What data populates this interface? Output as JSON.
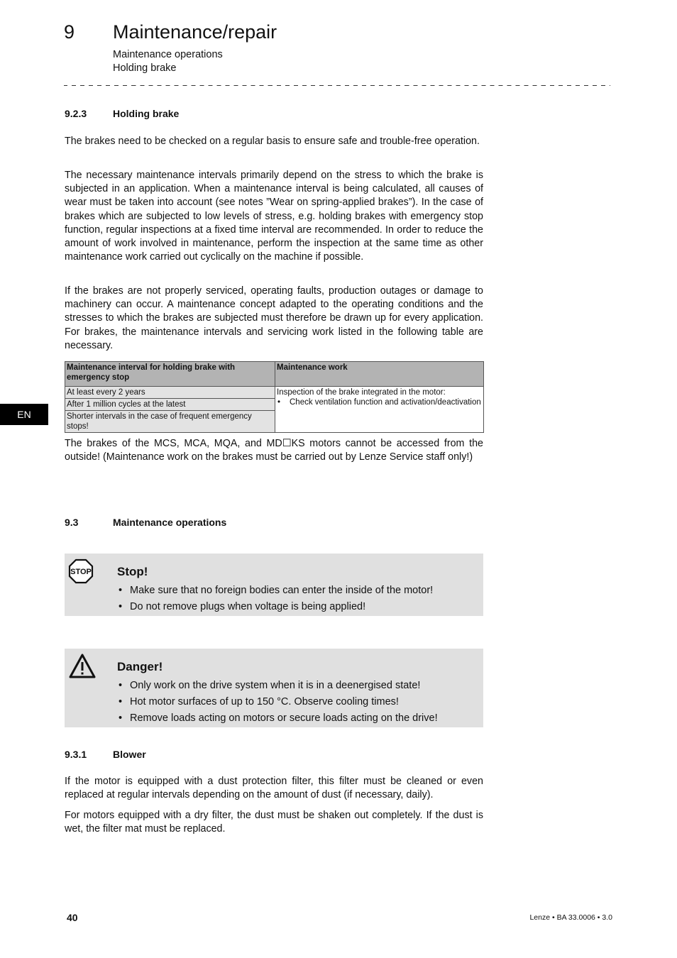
{
  "header": {
    "chapter_number": "9",
    "chapter_title": "Maintenance/repair",
    "subheadings": [
      "Maintenance operations",
      "Holding brake"
    ]
  },
  "side_tab": {
    "language": "EN"
  },
  "section_923": {
    "number": "9.2.3",
    "title": "Holding brake",
    "paragraphs": [
      "The brakes need to be checked on a regular basis to ensure safe and trouble-free operation.",
      "The necessary maintenance intervals primarily depend on the stress to which the brake is subjected in an application. When a maintenance interval is being calculated, all causes of wear must be taken into account (see notes ”Wear on spring-applied brakes”). In the case of brakes which are subjected to low levels of stress, e.g. holding brakes with emergency stop function, regular inspections at a fixed time interval are recommended. In order to reduce the amount of work involved in maintenance, perform the inspection at the same time as other maintenance work carried out cyclically on the machine if possible.",
      "If the brakes are not properly serviced, operating faults, production outages or damage to machinery can occur. A maintenance concept adapted to the operating conditions and the stresses to which the brakes are subjected must therefore be drawn up for every application. For brakes, the maintenance intervals and servicing work listed in the following table are necessary."
    ],
    "table": {
      "headers": [
        "Maintenance interval for holding brake with emergency stop",
        "Maintenance work"
      ],
      "intervals": [
        "At least every 2 years",
        "After 1 million cycles at the latest",
        "Shorter intervals in the case of frequent emergency stops!"
      ],
      "work_intro": "Inspection of the brake integrated in the motor:",
      "work_items": [
        "Check ventilation function and activation/deactivation"
      ]
    },
    "note_after_table": "The brakes of the MCS, MCA, MQA, and MD☐KS motors cannot be accessed from the outside! (Maintenance work on the brakes must be carried out by Lenze Service staff only!)"
  },
  "section_93": {
    "number": "9.3",
    "title": "Maintenance operations",
    "stop_box": {
      "icon": "stop-sign-icon",
      "icon_text": "STOP",
      "title": "Stop!",
      "items": [
        "Make sure that no foreign bodies can enter the inside of the motor!",
        "Do not remove plugs when voltage is being applied!"
      ]
    },
    "danger_box": {
      "icon": "warning-triangle-icon",
      "title": "Danger!",
      "items": [
        "Only work on the drive system when it is in a deenergised state!",
        "Hot motor surfaces of up to 150 °C. Observe cooling times!",
        "Remove loads acting on motors or secure loads acting on the drive!"
      ]
    }
  },
  "section_931": {
    "number": "9.3.1",
    "title": "Blower",
    "paragraphs": [
      "If the motor is equipped with a dust protection filter, this filter must be cleaned or even replaced at regular intervals depending on the amount of dust (if necessary, daily).",
      "For motors equipped with a dry filter, the dust must be shaken out completely. If the dust is wet, the filter mat must be replaced."
    ]
  },
  "footer": {
    "page_number": "40",
    "document_ref": "Lenze • BA 33.0006 • 3.0"
  }
}
